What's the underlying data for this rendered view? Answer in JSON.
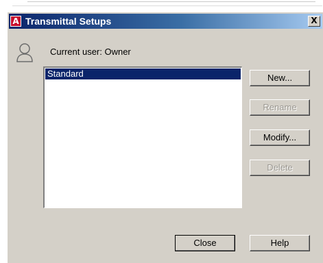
{
  "window": {
    "title": "Transmittal Setups",
    "app_icon_glyph": "A",
    "close_glyph": "X"
  },
  "user": {
    "label": "Current user: Owner",
    "icon": "user-icon"
  },
  "setups_list": {
    "items": [
      "Standard"
    ],
    "selected_index": 0
  },
  "buttons": {
    "new": "New...",
    "rename": "Rename",
    "modify": "Modify...",
    "delete": "Delete",
    "close": "Close",
    "help": "Help"
  },
  "colors": {
    "title_active": "#0a246a",
    "selection": "#0a246a",
    "dialog_bg": "#d4d0c8",
    "app_icon": "#c8102e"
  }
}
